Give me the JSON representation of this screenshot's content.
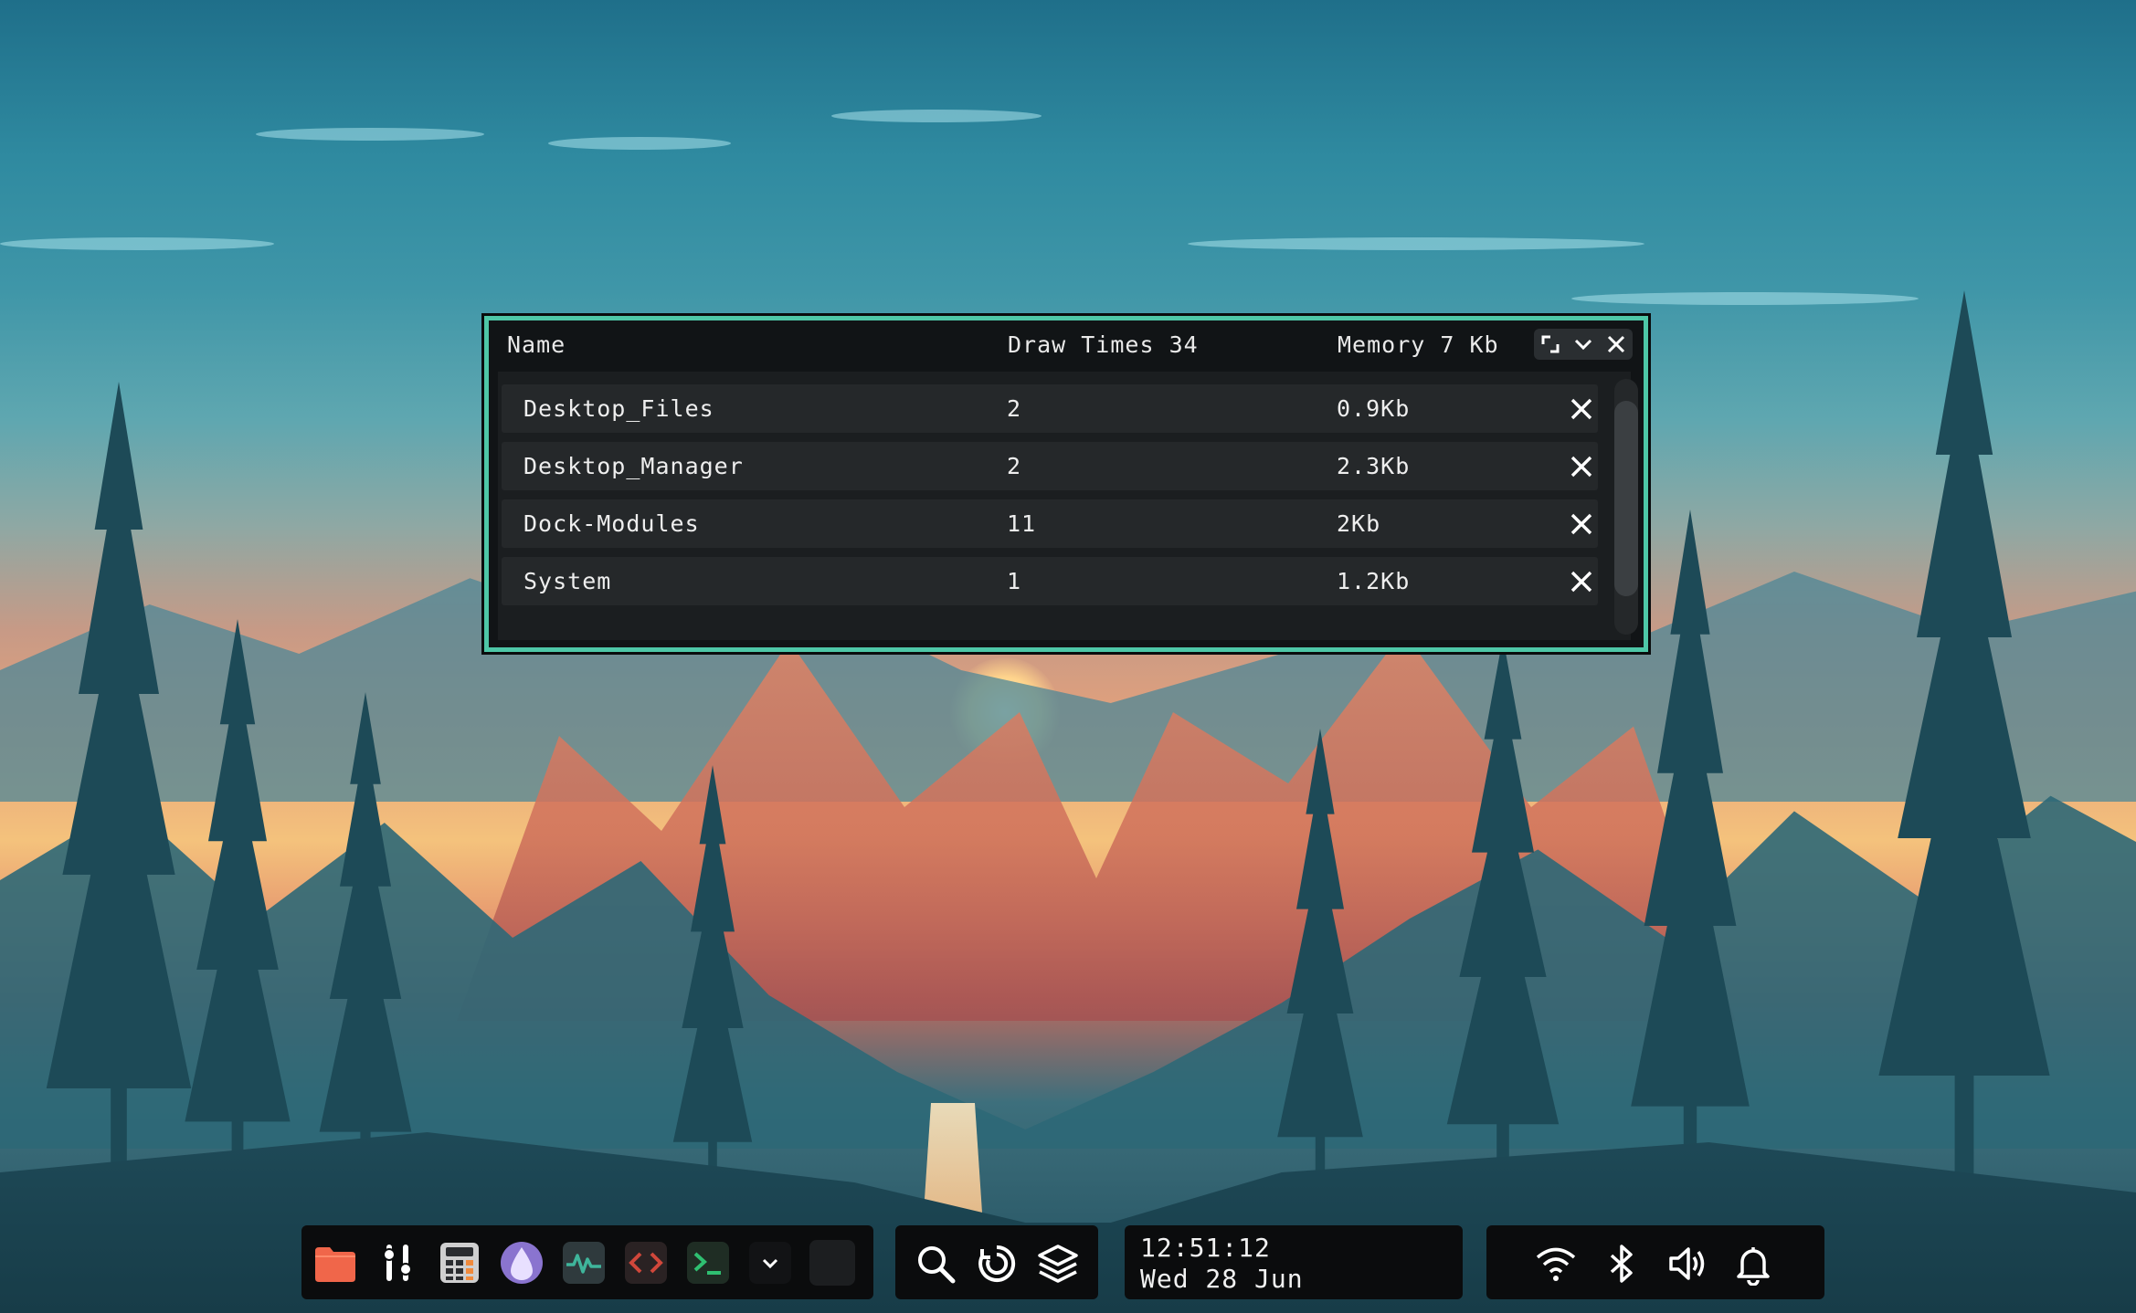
{
  "monitor": {
    "header": {
      "name": "Name",
      "draw_times": "Draw Times 34",
      "memory": "Memory 7 Kb"
    },
    "controls": [
      "expand-icon",
      "minimize-icon",
      "close-icon"
    ],
    "rows": [
      {
        "name": "Desktop_Files",
        "draw": "2",
        "memory": "0.9Kb"
      },
      {
        "name": "Desktop_Manager",
        "draw": "2",
        "memory": "2.3Kb"
      },
      {
        "name": "Dock-Modules",
        "draw": "11",
        "memory": "2Kb"
      },
      {
        "name": "System",
        "draw": "1",
        "memory": "1.2Kb"
      }
    ],
    "accent_color": "#4ec7a7"
  },
  "dock": {
    "apps": [
      {
        "name": "folder-icon",
        "color": "#f0664a"
      },
      {
        "name": "settings-sliders-icon",
        "color": "#ffffff"
      },
      {
        "name": "calculator-icon",
        "color": "#b9b9b9"
      },
      {
        "name": "purple-drop-icon",
        "color": "#b49be4"
      },
      {
        "name": "activity-monitor-icon",
        "color": "#3fb59b"
      },
      {
        "name": "code-editor-icon",
        "color": "#c0392b"
      },
      {
        "name": "terminal-icon",
        "color": "#2fbf71"
      },
      {
        "name": "chevron-down-icon",
        "color": "#ffffff"
      },
      {
        "name": "blank-app-icon",
        "color": "#1c1e20"
      }
    ],
    "tools": [
      "search-icon",
      "refresh-icon",
      "layers-icon"
    ],
    "clock": {
      "time": "12:51:12",
      "date": "Wed 28 Jun"
    },
    "tray": [
      "wifi-icon",
      "bluetooth-icon",
      "volume-icon",
      "bell-icon"
    ]
  }
}
